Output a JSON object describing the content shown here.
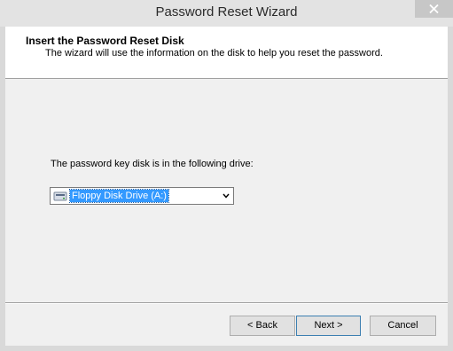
{
  "window": {
    "title": "Password Reset Wizard",
    "close_icon": "close-icon"
  },
  "header": {
    "title": "Insert the Password Reset Disk",
    "subtitle": "The wizard will use the information on the disk to help you reset the password."
  },
  "body": {
    "drive_label": "The password key disk is in the following drive:",
    "drive_select": {
      "value": "Floppy Disk Drive (A:)",
      "icon": "floppy-drive-icon"
    }
  },
  "buttons": {
    "back": "< Back",
    "next": "Next >",
    "cancel": "Cancel"
  },
  "colors": {
    "selection": "#3399ff",
    "default_button_border": "#3c7fb1",
    "chrome": "#d9d9d9"
  }
}
